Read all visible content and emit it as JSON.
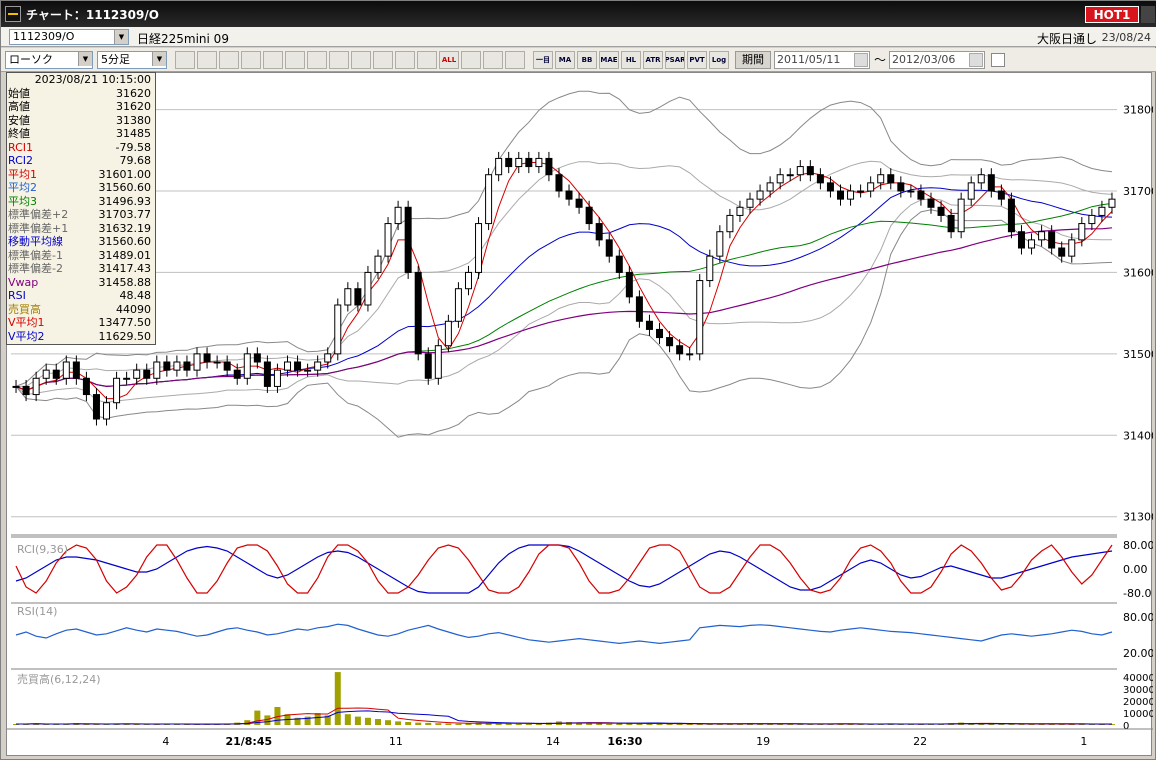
{
  "window": {
    "title": "チャート：1112309/O",
    "hot_badge": "HOT1"
  },
  "header": {
    "symbol_code": "1112309/O",
    "symbol_name": "日経225mini 09",
    "session": "大阪日通し",
    "date": "23/08/24"
  },
  "toolbar": {
    "chart_type": "ローソク",
    "interval": "5分足",
    "buttons": [
      "zoom-icon",
      "crosshair-icon",
      "download-icon",
      "magnifier-icon",
      "grid-icon",
      "compare-icon",
      "warning-icon",
      "pen-icon",
      "cursor-icon",
      "redo-icon",
      "split-icon",
      "merge-icon",
      "ALL",
      "fill-icon",
      "wrench-icon",
      "palette-icon"
    ],
    "indicator_buttons": [
      "一目",
      "MA",
      "BB",
      "MAE",
      "HL",
      "ATR",
      "PSAR",
      "PVT",
      "Log"
    ],
    "period_label": "期間",
    "date_from": "2011/05/11",
    "tilde": "～",
    "date_to": "2012/03/06"
  },
  "info": {
    "datetime": "2023/08/21  10:15:00",
    "rows": [
      {
        "label": "始値",
        "value": "31620",
        "color": "#000000"
      },
      {
        "label": "高値",
        "value": "31620",
        "color": "#000000"
      },
      {
        "label": "安値",
        "value": "31380",
        "color": "#000000"
      },
      {
        "label": "終値",
        "value": "31485",
        "color": "#000000"
      },
      {
        "label": "RCI1",
        "value": "-79.58",
        "color": "#d40000"
      },
      {
        "label": "RCI2",
        "value": "79.68",
        "color": "#0000c8"
      },
      {
        "label": "平均1",
        "value": "31601.00",
        "color": "#d40000"
      },
      {
        "label": "平均2",
        "value": "31560.60",
        "color": "#2060d0"
      },
      {
        "label": "平均3",
        "value": "31496.93",
        "color": "#008000"
      },
      {
        "label": "標準偏差+2",
        "value": "31703.77",
        "color": "#666666"
      },
      {
        "label": "標準偏差+1",
        "value": "31632.19",
        "color": "#666666"
      },
      {
        "label": "移動平均線",
        "value": "31560.60",
        "color": "#0000c8"
      },
      {
        "label": "標準偏差-1",
        "value": "31489.01",
        "color": "#666666"
      },
      {
        "label": "標準偏差-2",
        "value": "31417.43",
        "color": "#666666"
      },
      {
        "label": "Vwap",
        "value": "31458.88",
        "color": "#800080"
      },
      {
        "label": "RSI",
        "value": "48.48",
        "color": "#0000c8"
      },
      {
        "label": "売買高",
        "value": "44090",
        "color": "#a08000"
      },
      {
        "label": "V平均1",
        "value": "13477.50",
        "color": "#d40000"
      },
      {
        "label": "V平均2",
        "value": "11629.50",
        "color": "#0000c8"
      }
    ]
  },
  "panels": {
    "price_ticks": [
      "31800",
      "31700",
      "31600",
      "31500",
      "31400",
      "31300"
    ],
    "rci_label": "RCI(9,36)",
    "rci_ticks": [
      "80.00",
      "0.00",
      "-80.0"
    ],
    "rsi_label": "RSI(14)",
    "rsi_ticks": [
      "80.00",
      "20.00"
    ],
    "vol_label": "売買高(6,12,24)",
    "vol_ticks": [
      "40000",
      "30000",
      "20000",
      "10000",
      "0"
    ]
  },
  "x_labels": [
    "4",
    "21/8:45",
    "11",
    "14",
    "16:30",
    "19",
    "22",
    "1"
  ],
  "chart_data": {
    "type": "candlestick",
    "ylim": [
      31280,
      31840
    ],
    "close": [
      31460,
      31450,
      31470,
      31480,
      31470,
      31490,
      31470,
      31450,
      31420,
      31440,
      31470,
      31470,
      31480,
      31470,
      31490,
      31480,
      31490,
      31480,
      31500,
      31490,
      31490,
      31480,
      31470,
      31500,
      31490,
      31460,
      31480,
      31490,
      31480,
      31480,
      31490,
      31500,
      31560,
      31580,
      31560,
      31600,
      31620,
      31660,
      31680,
      31600,
      31500,
      31470,
      31510,
      31540,
      31580,
      31600,
      31660,
      31720,
      31740,
      31730,
      31740,
      31730,
      31740,
      31720,
      31700,
      31690,
      31680,
      31660,
      31640,
      31620,
      31600,
      31570,
      31540,
      31530,
      31520,
      31510,
      31500,
      31500,
      31590,
      31620,
      31650,
      31670,
      31680,
      31690,
      31700,
      31710,
      31720,
      31720,
      31730,
      31720,
      31710,
      31700,
      31690,
      31700,
      31700,
      31710,
      31720,
      31710,
      31700,
      31700,
      31690,
      31680,
      31670,
      31650,
      31690,
      31710,
      31720,
      31700,
      31690,
      31650,
      31630,
      31640,
      31650,
      31630,
      31620,
      31640,
      31660,
      31670,
      31680,
      31690
    ],
    "rci_fast": [
      10,
      -60,
      -80,
      -40,
      20,
      60,
      80,
      70,
      30,
      -40,
      -80,
      -60,
      -20,
      40,
      80,
      80,
      30,
      -30,
      -80,
      -80,
      -40,
      20,
      70,
      80,
      80,
      60,
      10,
      -50,
      -80,
      -80,
      -30,
      40,
      80,
      80,
      60,
      20,
      -40,
      -80,
      -80,
      -60,
      -20,
      30,
      70,
      80,
      70,
      30,
      -20,
      -70,
      -80,
      -80,
      -60,
      -10,
      50,
      80,
      80,
      70,
      20,
      -40,
      -80,
      -80,
      -70,
      -30,
      20,
      70,
      80,
      80,
      60,
      0,
      -60,
      -80,
      -80,
      -60,
      -10,
      40,
      80,
      80,
      60,
      20,
      -30,
      -70,
      -80,
      -70,
      -30,
      30,
      70,
      80,
      60,
      20,
      -40,
      -80,
      -80,
      -60,
      -10,
      50,
      80,
      60,
      20,
      -30,
      -70,
      -60,
      -20,
      30,
      60,
      80,
      40,
      -10,
      -50,
      -20,
      30,
      80
    ],
    "rci_slow": [
      -40,
      -30,
      -10,
      10,
      30,
      40,
      40,
      35,
      30,
      20,
      10,
      0,
      -10,
      -10,
      0,
      20,
      40,
      60,
      70,
      75,
      70,
      60,
      40,
      20,
      0,
      -20,
      -30,
      -20,
      0,
      20,
      40,
      55,
      60,
      55,
      40,
      20,
      0,
      -20,
      -40,
      -60,
      -75,
      -80,
      -80,
      -80,
      -80,
      -80,
      -60,
      -20,
      20,
      50,
      70,
      80,
      80,
      80,
      80,
      75,
      60,
      40,
      20,
      0,
      -20,
      -40,
      -55,
      -60,
      -50,
      -30,
      -10,
      10,
      30,
      50,
      60,
      55,
      40,
      20,
      0,
      -20,
      -40,
      -60,
      -70,
      -70,
      -60,
      -40,
      -20,
      0,
      20,
      30,
      20,
      0,
      -20,
      -30,
      -25,
      -10,
      5,
      10,
      0,
      -10,
      -20,
      -30,
      -30,
      -20,
      -10,
      0,
      10,
      20,
      30,
      40,
      45,
      50,
      55,
      60
    ],
    "rsi": [
      50,
      55,
      48,
      45,
      52,
      58,
      60,
      55,
      50,
      52,
      57,
      62,
      58,
      55,
      60,
      58,
      56,
      52,
      48,
      50,
      55,
      60,
      62,
      58,
      55,
      50,
      52,
      56,
      60,
      58,
      62,
      64,
      68,
      66,
      60,
      55,
      50,
      48,
      52,
      58,
      62,
      66,
      60,
      55,
      50,
      46,
      48,
      52,
      54,
      50,
      46,
      42,
      40,
      38,
      40,
      42,
      44,
      42,
      40,
      38,
      36,
      38,
      40,
      38,
      36,
      38,
      40,
      42,
      62,
      64,
      66,
      65,
      64,
      66,
      67,
      66,
      64,
      62,
      60,
      58,
      56,
      55,
      58,
      60,
      62,
      60,
      58,
      56,
      55,
      54,
      52,
      50,
      48,
      46,
      44,
      42,
      40,
      45,
      50,
      52,
      50,
      48,
      50,
      52,
      55,
      58,
      56,
      52,
      50,
      55
    ],
    "volume": [
      800,
      900,
      1200,
      600,
      700,
      900,
      1500,
      800,
      700,
      600,
      900,
      1100,
      800,
      700,
      600,
      900,
      1000,
      700,
      600,
      800,
      700,
      900,
      2000,
      4000,
      12000,
      8000,
      15000,
      9000,
      6000,
      7000,
      10000,
      8000,
      44090,
      9000,
      7000,
      6000,
      5000,
      4000,
      3000,
      2500,
      2000,
      1800,
      1500,
      1200,
      1000,
      1500,
      2000,
      1800,
      1500,
      1200,
      1000,
      900,
      800,
      2000,
      3000,
      2500,
      2000,
      1500,
      1200,
      1000,
      1500,
      1800,
      1200,
      1000,
      900,
      800,
      1200,
      1000,
      900,
      800,
      700,
      900,
      1100,
      1500,
      1200,
      1000,
      900,
      800,
      700,
      600,
      900,
      1000,
      1200,
      800,
      700,
      600,
      900,
      1100,
      800,
      700,
      600,
      900,
      1000,
      1500,
      2000,
      1500,
      1000,
      900,
      800,
      700,
      600,
      900,
      1100,
      800,
      700,
      600,
      1200,
      800,
      600,
      700
    ]
  }
}
